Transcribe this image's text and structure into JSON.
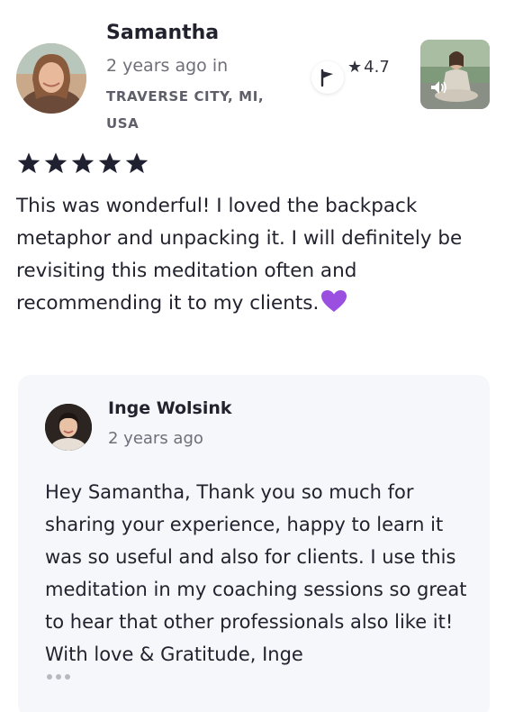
{
  "review": {
    "reviewer_name": "Samantha",
    "time": "2 years ago in",
    "location": "TRAVERSE CITY, MI, USA",
    "rating_value": "4.7",
    "stars": 5,
    "body": "This was wonderful! I loved the backpack metaphor and unpacking it. I will definitely be revisiting this meditation often and recommending it to my clients.",
    "icons": {
      "avatar": "reviewer-avatar",
      "flag": "flag-icon",
      "rating_star": "star-icon",
      "thumbnail_badge": "speaker-icon",
      "emoji": "purple-heart-icon"
    }
  },
  "reply": {
    "author_name": "Inge Wolsink",
    "time": "2 years ago",
    "body": "Hey Samantha, Thank you so much for sharing your experience, happy to learn it was so useful and also for clients. I use this meditation in my coaching sessions so great to hear that other professionals also like it! With love & Gratitude, Inge",
    "more_icon": "more-dots-icon"
  },
  "colors": {
    "star": "#1f2030",
    "heart": "#9b4fe0",
    "card_bg": "#f6f7fa"
  }
}
